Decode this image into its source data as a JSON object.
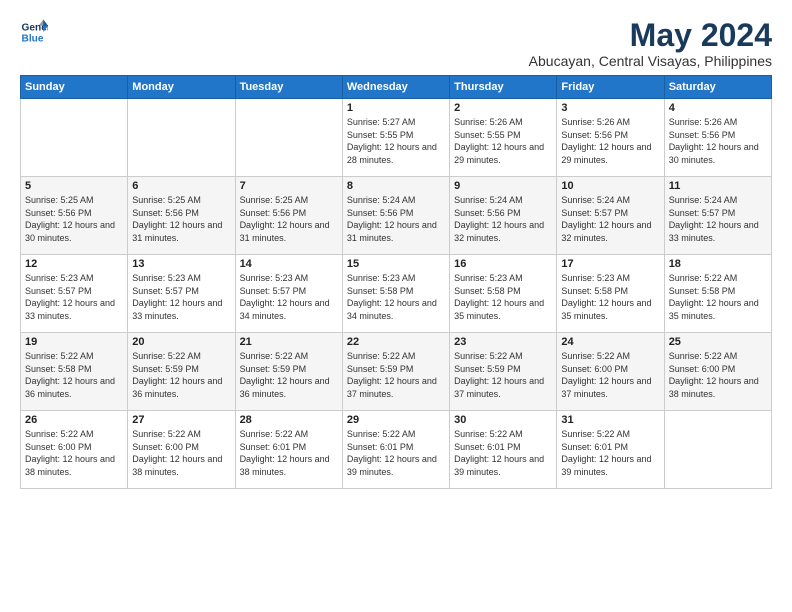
{
  "logo": {
    "line1": "General",
    "line2": "Blue"
  },
  "title": "May 2024",
  "subtitle": "Abucayan, Central Visayas, Philippines",
  "weekdays": [
    "Sunday",
    "Monday",
    "Tuesday",
    "Wednesday",
    "Thursday",
    "Friday",
    "Saturday"
  ],
  "weeks": [
    [
      {
        "day": "",
        "sunrise": "",
        "sunset": "",
        "daylight": ""
      },
      {
        "day": "",
        "sunrise": "",
        "sunset": "",
        "daylight": ""
      },
      {
        "day": "",
        "sunrise": "",
        "sunset": "",
        "daylight": ""
      },
      {
        "day": "1",
        "sunrise": "Sunrise: 5:27 AM",
        "sunset": "Sunset: 5:55 PM",
        "daylight": "Daylight: 12 hours and 28 minutes."
      },
      {
        "day": "2",
        "sunrise": "Sunrise: 5:26 AM",
        "sunset": "Sunset: 5:55 PM",
        "daylight": "Daylight: 12 hours and 29 minutes."
      },
      {
        "day": "3",
        "sunrise": "Sunrise: 5:26 AM",
        "sunset": "Sunset: 5:56 PM",
        "daylight": "Daylight: 12 hours and 29 minutes."
      },
      {
        "day": "4",
        "sunrise": "Sunrise: 5:26 AM",
        "sunset": "Sunset: 5:56 PM",
        "daylight": "Daylight: 12 hours and 30 minutes."
      }
    ],
    [
      {
        "day": "5",
        "sunrise": "Sunrise: 5:25 AM",
        "sunset": "Sunset: 5:56 PM",
        "daylight": "Daylight: 12 hours and 30 minutes."
      },
      {
        "day": "6",
        "sunrise": "Sunrise: 5:25 AM",
        "sunset": "Sunset: 5:56 PM",
        "daylight": "Daylight: 12 hours and 31 minutes."
      },
      {
        "day": "7",
        "sunrise": "Sunrise: 5:25 AM",
        "sunset": "Sunset: 5:56 PM",
        "daylight": "Daylight: 12 hours and 31 minutes."
      },
      {
        "day": "8",
        "sunrise": "Sunrise: 5:24 AM",
        "sunset": "Sunset: 5:56 PM",
        "daylight": "Daylight: 12 hours and 31 minutes."
      },
      {
        "day": "9",
        "sunrise": "Sunrise: 5:24 AM",
        "sunset": "Sunset: 5:56 PM",
        "daylight": "Daylight: 12 hours and 32 minutes."
      },
      {
        "day": "10",
        "sunrise": "Sunrise: 5:24 AM",
        "sunset": "Sunset: 5:57 PM",
        "daylight": "Daylight: 12 hours and 32 minutes."
      },
      {
        "day": "11",
        "sunrise": "Sunrise: 5:24 AM",
        "sunset": "Sunset: 5:57 PM",
        "daylight": "Daylight: 12 hours and 33 minutes."
      }
    ],
    [
      {
        "day": "12",
        "sunrise": "Sunrise: 5:23 AM",
        "sunset": "Sunset: 5:57 PM",
        "daylight": "Daylight: 12 hours and 33 minutes."
      },
      {
        "day": "13",
        "sunrise": "Sunrise: 5:23 AM",
        "sunset": "Sunset: 5:57 PM",
        "daylight": "Daylight: 12 hours and 33 minutes."
      },
      {
        "day": "14",
        "sunrise": "Sunrise: 5:23 AM",
        "sunset": "Sunset: 5:57 PM",
        "daylight": "Daylight: 12 hours and 34 minutes."
      },
      {
        "day": "15",
        "sunrise": "Sunrise: 5:23 AM",
        "sunset": "Sunset: 5:58 PM",
        "daylight": "Daylight: 12 hours and 34 minutes."
      },
      {
        "day": "16",
        "sunrise": "Sunrise: 5:23 AM",
        "sunset": "Sunset: 5:58 PM",
        "daylight": "Daylight: 12 hours and 35 minutes."
      },
      {
        "day": "17",
        "sunrise": "Sunrise: 5:23 AM",
        "sunset": "Sunset: 5:58 PM",
        "daylight": "Daylight: 12 hours and 35 minutes."
      },
      {
        "day": "18",
        "sunrise": "Sunrise: 5:22 AM",
        "sunset": "Sunset: 5:58 PM",
        "daylight": "Daylight: 12 hours and 35 minutes."
      }
    ],
    [
      {
        "day": "19",
        "sunrise": "Sunrise: 5:22 AM",
        "sunset": "Sunset: 5:58 PM",
        "daylight": "Daylight: 12 hours and 36 minutes."
      },
      {
        "day": "20",
        "sunrise": "Sunrise: 5:22 AM",
        "sunset": "Sunset: 5:59 PM",
        "daylight": "Daylight: 12 hours and 36 minutes."
      },
      {
        "day": "21",
        "sunrise": "Sunrise: 5:22 AM",
        "sunset": "Sunset: 5:59 PM",
        "daylight": "Daylight: 12 hours and 36 minutes."
      },
      {
        "day": "22",
        "sunrise": "Sunrise: 5:22 AM",
        "sunset": "Sunset: 5:59 PM",
        "daylight": "Daylight: 12 hours and 37 minutes."
      },
      {
        "day": "23",
        "sunrise": "Sunrise: 5:22 AM",
        "sunset": "Sunset: 5:59 PM",
        "daylight": "Daylight: 12 hours and 37 minutes."
      },
      {
        "day": "24",
        "sunrise": "Sunrise: 5:22 AM",
        "sunset": "Sunset: 6:00 PM",
        "daylight": "Daylight: 12 hours and 37 minutes."
      },
      {
        "day": "25",
        "sunrise": "Sunrise: 5:22 AM",
        "sunset": "Sunset: 6:00 PM",
        "daylight": "Daylight: 12 hours and 38 minutes."
      }
    ],
    [
      {
        "day": "26",
        "sunrise": "Sunrise: 5:22 AM",
        "sunset": "Sunset: 6:00 PM",
        "daylight": "Daylight: 12 hours and 38 minutes."
      },
      {
        "day": "27",
        "sunrise": "Sunrise: 5:22 AM",
        "sunset": "Sunset: 6:00 PM",
        "daylight": "Daylight: 12 hours and 38 minutes."
      },
      {
        "day": "28",
        "sunrise": "Sunrise: 5:22 AM",
        "sunset": "Sunset: 6:01 PM",
        "daylight": "Daylight: 12 hours and 38 minutes."
      },
      {
        "day": "29",
        "sunrise": "Sunrise: 5:22 AM",
        "sunset": "Sunset: 6:01 PM",
        "daylight": "Daylight: 12 hours and 39 minutes."
      },
      {
        "day": "30",
        "sunrise": "Sunrise: 5:22 AM",
        "sunset": "Sunset: 6:01 PM",
        "daylight": "Daylight: 12 hours and 39 minutes."
      },
      {
        "day": "31",
        "sunrise": "Sunrise: 5:22 AM",
        "sunset": "Sunset: 6:01 PM",
        "daylight": "Daylight: 12 hours and 39 minutes."
      },
      {
        "day": "",
        "sunrise": "",
        "sunset": "",
        "daylight": ""
      }
    ]
  ]
}
